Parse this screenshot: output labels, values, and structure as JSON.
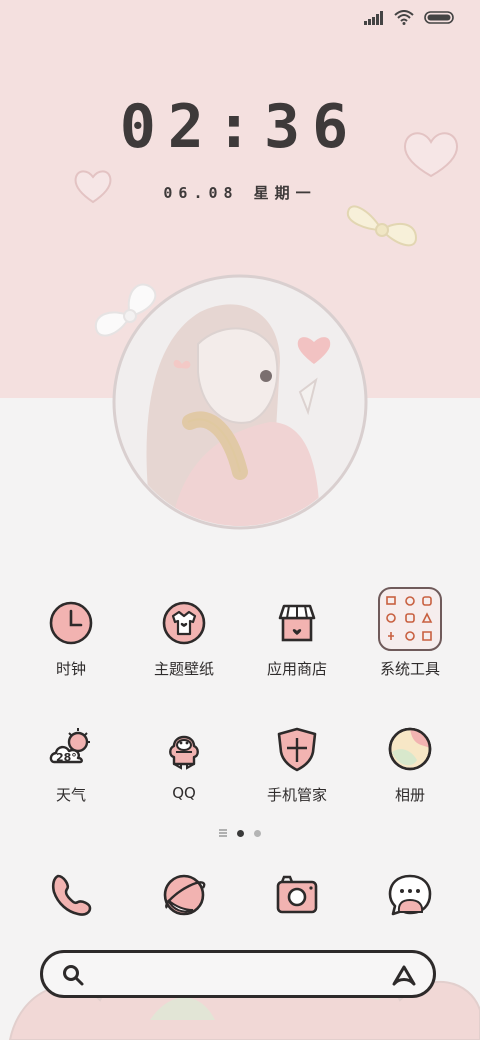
{
  "status_bar": {
    "signal_icon": "signal-icon",
    "wifi_icon": "wifi-icon",
    "battery_icon": "battery-icon"
  },
  "lockscreen": {
    "time": "02:36",
    "date": "06.08 星期一"
  },
  "apps": [
    {
      "label": "时钟",
      "icon": "clock-icon"
    },
    {
      "label": "主题壁纸",
      "icon": "theme-wallpaper-icon"
    },
    {
      "label": "应用商店",
      "icon": "app-store-icon"
    },
    {
      "label": "系统工具",
      "icon": "system-tools-folder-icon"
    },
    {
      "label": "天气",
      "icon": "weather-icon",
      "temp": "28°"
    },
    {
      "label": "QQ",
      "icon": "qq-penguin-icon"
    },
    {
      "label": "手机管家",
      "icon": "phone-manager-shield-icon"
    },
    {
      "label": "相册",
      "icon": "gallery-icon"
    }
  ],
  "dock": [
    {
      "icon": "phone-icon"
    },
    {
      "icon": "browser-planet-icon"
    },
    {
      "icon": "camera-icon"
    },
    {
      "icon": "messages-icon"
    }
  ],
  "search": {
    "search_icon": "search-icon",
    "assistant_icon": "assistant-icon"
  },
  "colors": {
    "top_bg": "#f4e0df",
    "bottom_bg": "#f4f3f3",
    "accent_pink": "#f2b3b1",
    "ink": "#2d2a2a"
  }
}
